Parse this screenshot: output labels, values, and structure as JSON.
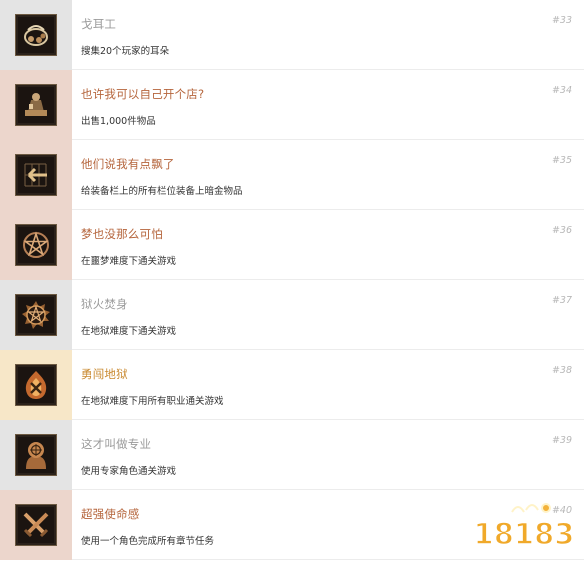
{
  "colors": {
    "title_gray": "#9b9b9b",
    "title_orange": "#b5653c",
    "title_gold": "#c9892f",
    "side_gray": "#e4e4e4",
    "side_pink": "#ecd6cc",
    "side_cream": "#f7e7c8"
  },
  "achievements": [
    {
      "title": "戈耳工",
      "desc": "搜集20个玩家的耳朵",
      "num": "#33",
      "icon": "ear-bundle-icon",
      "title_color": "#9b9b9b",
      "side_color": "#e4e4e4"
    },
    {
      "title": "也许我可以自己开个店?",
      "desc": "出售1,000件物品",
      "num": "#34",
      "icon": "merchant-icon",
      "title_color": "#b5653c",
      "side_color": "#ecd6cc"
    },
    {
      "title": "他们说我有点飘了",
      "desc": "给装备栏上的所有栏位装备上暗金物品",
      "num": "#35",
      "icon": "arrow-grid-icon",
      "title_color": "#b5653c",
      "side_color": "#ecd6cc"
    },
    {
      "title": "梦也没那么可怕",
      "desc": "在噩梦难度下通关游戏",
      "num": "#36",
      "icon": "pentagram-icon",
      "title_color": "#b5653c",
      "side_color": "#ecd6cc"
    },
    {
      "title": "狱火焚身",
      "desc": "在地狱难度下通关游戏",
      "num": "#37",
      "icon": "flaming-pentagram-icon",
      "title_color": "#9b9b9b",
      "side_color": "#e4e4e4"
    },
    {
      "title": "勇闯地狱",
      "desc": "在地狱难度下用所有职业通关游戏",
      "num": "#38",
      "icon": "fire-swords-icon",
      "title_color": "#c9892f",
      "side_color": "#f7e7c8"
    },
    {
      "title": "这才叫做专业",
      "desc": "使用专家角色通关游戏",
      "num": "#39",
      "icon": "expert-head-icon",
      "title_color": "#9b9b9b",
      "side_color": "#e4e4e4"
    },
    {
      "title": "超强使命感",
      "desc": "使用一个角色完成所有章节任务",
      "num": "#40",
      "icon": "crossed-swords-icon",
      "title_color": "#b5653c",
      "side_color": "#ecd6cc"
    }
  ],
  "watermark": {
    "text": "18183"
  }
}
